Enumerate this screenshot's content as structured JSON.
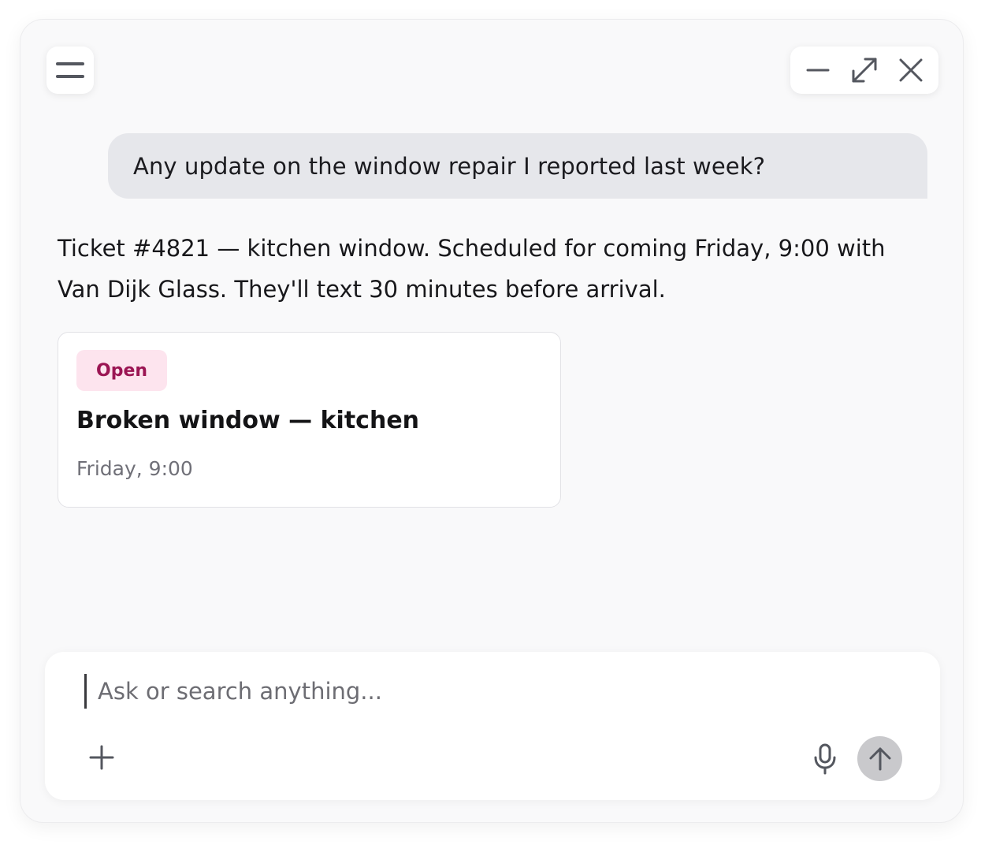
{
  "header": {
    "menu_icon": "menu-icon",
    "controls": [
      "minimize-icon",
      "expand-icon",
      "close-icon"
    ]
  },
  "conversation": {
    "user_message": "Any update on the window repair I reported last week?",
    "assistant_reply": "Ticket #4821 — kitchen window. Scheduled for coming Friday, 9:00 with Van Dijk Glass. They'll text 30 minutes before arrival."
  },
  "ticket": {
    "status": "Open",
    "status_color": "#9b1553",
    "status_bg": "#fde4ee",
    "title": "Broken window — kitchen",
    "time": "Friday, 9:00"
  },
  "composer": {
    "placeholder": "Ask or search anything...",
    "value": "",
    "icons": [
      "plus-icon",
      "microphone-icon",
      "arrow-up-icon"
    ]
  }
}
